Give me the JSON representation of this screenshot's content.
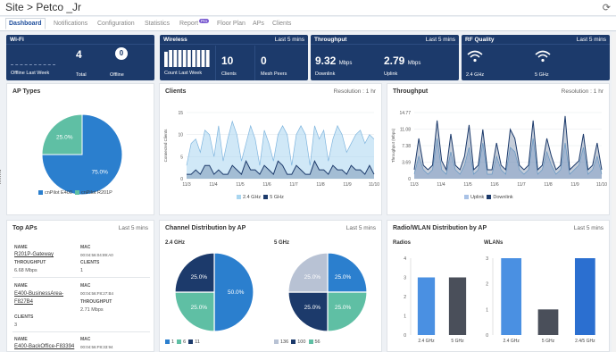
{
  "header": {
    "title": "Site > Petco _Jr"
  },
  "tabs": [
    {
      "label": "Dashboard",
      "active": true
    },
    {
      "label": "Notifications"
    },
    {
      "label": "Configuration"
    },
    {
      "label": "Statistics"
    },
    {
      "label": "Report",
      "badge": "Pro"
    },
    {
      "label": "Floor Plan"
    },
    {
      "label": "APs"
    },
    {
      "label": "Clients"
    }
  ],
  "kpi": {
    "wifi": {
      "title": "Wi-Fi",
      "offline_last_week": "Offline Last Week",
      "total_value": "4",
      "total_label": "Total",
      "offline_value": "0",
      "offline_label": "Offline"
    },
    "wireless": {
      "title": "Wireless",
      "range": "Last 5 mins",
      "count_label": "Count Last Week",
      "count_bars": [
        0.9,
        1,
        1,
        1,
        1,
        1,
        1,
        1,
        1,
        1
      ],
      "clients_value": "10",
      "clients_label": "Clients",
      "mesh_value": "0",
      "mesh_label": "Mesh Peers"
    },
    "throughput": {
      "title": "Throughput",
      "range": "Last 5 mins",
      "down_value": "9.32",
      "down_unit": "Mbps",
      "down_label": "Downlink",
      "up_value": "2.79",
      "up_unit": "Mbps",
      "up_label": "Uplink"
    },
    "rf": {
      "title": "RF Quality",
      "range": "Last 5 mins",
      "label_24": "2.4 GHz",
      "label_5": "5 GHz"
    }
  },
  "ap_types": {
    "title": "AP Types",
    "legend": [
      "cnPilot E400",
      "cnPilot R201P"
    ],
    "colors": [
      "#2b7fce",
      "#5fbfa4"
    ]
  },
  "clients_panel": {
    "title": "Clients",
    "resolution": "Resolution : 1 hr",
    "legend_24": "2.4 GHz",
    "legend_5": "5 GHz",
    "colors": {
      "ghz24": "#a9d6f0",
      "ghz5": "#1c3a6b"
    }
  },
  "throughput_panel": {
    "title": "Throughput",
    "resolution": "Resolution : 1 hr",
    "legend_up": "Uplink",
    "legend_down": "Downlink",
    "colors": {
      "uplink": "#a9c2e6",
      "downlink": "#1c3a6b"
    }
  },
  "top_aps": {
    "title": "Top APs",
    "range": "Last 5 mins",
    "name_label": "NAME",
    "mac_label": "MAC",
    "throughput_label": "THROUGHPUT",
    "clients_label": "CLIENTS",
    "aps": [
      {
        "name": "R201P-Gateway",
        "mac": "00:04:56:04:89:A0",
        "throughput": "6.68 Mbps",
        "clients": "1"
      },
      {
        "name": "E400-BusinessArea-F827B4",
        "mac": "00:04:56:F8:27:B4",
        "throughput": "2.71 Mbps",
        "clients": "3"
      },
      {
        "name": "E400-BackOffice-F83394",
        "mac": "00:04:56:F8:33:94"
      }
    ]
  },
  "channel_dist": {
    "title": "Channel Distribution by AP",
    "range": "Last 5 mins",
    "sub_24": "2.4 GHz",
    "sub_5": "5 GHz",
    "legend_24": [
      "1",
      "6",
      "11"
    ],
    "legend_5": [
      "136",
      "100",
      "56"
    ]
  },
  "radio_wlan": {
    "title": "Radio/WLAN Distribution by AP",
    "range": "Last 5 mins",
    "radios_title": "Radios",
    "wlans_title": "WLANs"
  },
  "chart_data": [
    {
      "type": "pie",
      "title": "AP Types",
      "categories": [
        "cnPilot E400",
        "cnPilot R201P"
      ],
      "values": [
        75,
        25
      ],
      "data_labels": [
        "75.0%",
        "25.0%"
      ]
    },
    {
      "type": "area",
      "title": "Clients",
      "x_ticks": [
        "11/3",
        "11/4",
        "11/5",
        "11/6",
        "11/7",
        "11/8",
        "11/9",
        "11/10"
      ],
      "ylabel": "Connected Clients",
      "ylim": [
        0,
        15
      ],
      "y_ticks": [
        "0",
        "5",
        "10",
        "15"
      ],
      "series": [
        {
          "name": "2.4 GHz",
          "values": [
            3,
            8,
            9,
            6,
            11,
            10,
            5,
            12,
            4,
            9,
            13,
            10,
            4,
            8,
            12,
            9,
            3,
            11,
            8,
            4,
            10,
            12,
            10,
            3,
            10,
            12,
            10,
            3,
            12,
            9,
            11,
            4,
            9,
            12,
            10,
            6,
            8,
            10,
            11,
            8,
            10,
            9
          ]
        },
        {
          "name": "5 GHz",
          "values": [
            1,
            1,
            2,
            1,
            3,
            3,
            1,
            2,
            1,
            1,
            3,
            2,
            1,
            4,
            2,
            2,
            1,
            3,
            2,
            1,
            4,
            3,
            1,
            1,
            3,
            2,
            1,
            1,
            4,
            2,
            2,
            1,
            3,
            2,
            2,
            1,
            3,
            2,
            2,
            1,
            3,
            1
          ]
        }
      ]
    },
    {
      "type": "area",
      "title": "Throughput",
      "ylabel": "Throughput (Mbps)",
      "x_ticks": [
        "11/3",
        "11/4",
        "11/5",
        "11/6",
        "11/7",
        "11/8",
        "11/9",
        "11/10"
      ],
      "y_ticks": [
        "0",
        "3.69",
        "7.38",
        "11.08",
        "14.77"
      ],
      "ylim": [
        0,
        14.77
      ],
      "series": [
        {
          "name": "Uplink",
          "values": [
            1,
            5,
            2,
            1,
            2,
            9,
            2,
            1,
            6,
            2,
            1,
            3,
            7,
            1,
            2,
            8,
            1,
            1,
            5,
            2,
            1,
            7,
            6,
            2,
            1,
            2,
            9,
            1,
            2,
            6,
            3,
            1,
            2,
            8,
            1,
            2,
            3,
            7,
            1,
            2,
            5,
            1
          ]
        },
        {
          "name": "Downlink",
          "values": [
            2,
            9,
            3,
            2,
            3,
            13,
            4,
            2,
            10,
            3,
            2,
            5,
            12,
            2,
            3,
            11,
            2,
            2,
            8,
            3,
            2,
            11,
            9,
            3,
            2,
            3,
            13,
            2,
            3,
            9,
            5,
            2,
            3,
            14,
            2,
            3,
            4,
            10,
            2,
            3,
            8,
            2
          ]
        }
      ]
    },
    {
      "type": "pie",
      "title": "2.4 GHz",
      "categories": [
        "1",
        "6",
        "11"
      ],
      "values": [
        50,
        25,
        25
      ],
      "data_labels": [
        "50.0%",
        "25.0%",
        "25.0%"
      ],
      "colors": [
        "#2b7fce",
        "#5fbfa4",
        "#1c3a6b"
      ]
    },
    {
      "type": "pie",
      "title": "5 GHz",
      "categories": [
        "136",
        "100",
        "56"
      ],
      "values": [
        25,
        25,
        25,
        25
      ],
      "data_labels": [
        "25.0%",
        "25.0%",
        "25.0%",
        "25.0%"
      ],
      "colors": [
        "#2b7fce",
        "#5fbfa4",
        "#1c3a6b",
        "#b8c2d4"
      ]
    },
    {
      "type": "bar",
      "title": "Radios",
      "categories": [
        "2.4 GHz",
        "5 GHz"
      ],
      "values": [
        3,
        3
      ],
      "ylim": [
        0,
        4
      ],
      "y_ticks": [
        "0",
        "1",
        "2",
        "3",
        "4"
      ],
      "colors": [
        "#4a90e2",
        "#4a4f5a"
      ]
    },
    {
      "type": "bar",
      "title": "WLANs",
      "categories": [
        "2.4 GHz",
        "5 GHz",
        "2.4/5 GHz"
      ],
      "values": [
        3,
        1,
        3
      ],
      "ylim": [
        0,
        3
      ],
      "y_ticks": [
        "0",
        "1",
        "2",
        "3"
      ],
      "colors": [
        "#4a90e2",
        "#4a4f5a",
        "#2b6fd0"
      ]
    }
  ]
}
